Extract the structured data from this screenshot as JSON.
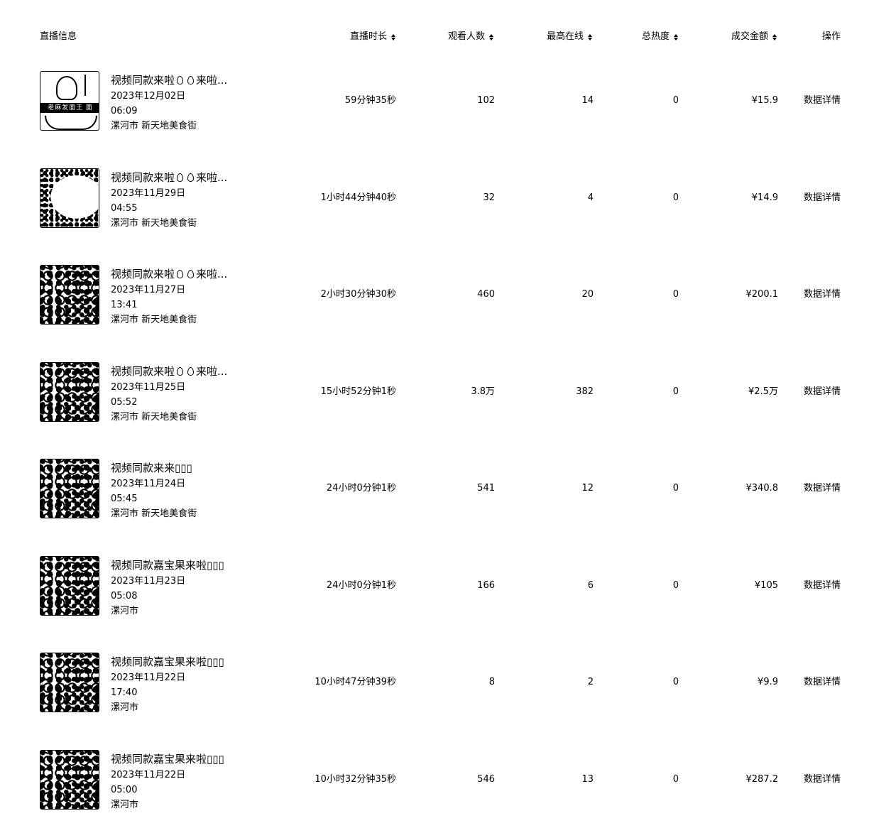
{
  "columns": {
    "info": "直播信息",
    "duration": "直播时长",
    "viewers": "观看人数",
    "peak": "最高在线",
    "heat": "总热度",
    "gmv": "成交金额",
    "ops": "操作"
  },
  "rows": [
    {
      "title_a": "视频同款来啦",
      "title_b": "来啦...",
      "title_icons": 2,
      "date": "2023年12月02日",
      "time": "06:09",
      "location": "漯河市 新天地美食街",
      "thumb": "poster",
      "thumb_text": "老麻发面王 面",
      "duration": "59分钟35秒",
      "viewers": "102",
      "peak": "14",
      "heat": "0",
      "gmv": "¥15.9",
      "action": "数据详情"
    },
    {
      "title_a": "视频同款来啦",
      "title_b": "来啦...",
      "title_icons": 2,
      "date": "2023年11月29日",
      "time": "04:55",
      "location": "漯河市 新天地美食街",
      "thumb": "dog",
      "duration": "1小时44分钟40秒",
      "viewers": "32",
      "peak": "4",
      "heat": "0",
      "gmv": "¥14.9",
      "action": "数据详情"
    },
    {
      "title_a": "视频同款来啦",
      "title_b": "来啦...",
      "title_icons": 2,
      "date": "2023年11月27日",
      "time": "13:41",
      "location": "漯河市 新天地美食街",
      "thumb": "noise",
      "duration": "2小时30分钟30秒",
      "viewers": "460",
      "peak": "20",
      "heat": "0",
      "gmv": "¥200.1",
      "action": "数据详情"
    },
    {
      "title_a": "视频同款来啦",
      "title_b": "来啦...",
      "title_icons": 2,
      "date": "2023年11月25日",
      "time": "05:52",
      "location": "漯河市 新天地美食街",
      "thumb": "noise",
      "duration": "15小时52分钟1秒",
      "viewers": "3.8万",
      "peak": "382",
      "heat": "0",
      "gmv": "¥2.5万",
      "action": "数据详情"
    },
    {
      "title_a": "视频同款来来▯▯▯",
      "title_b": "",
      "title_icons": 0,
      "date": "2023年11月24日",
      "time": "05:45",
      "location": "漯河市 新天地美食街",
      "thumb": "noise",
      "duration": "24小时0分钟1秒",
      "viewers": "541",
      "peak": "12",
      "heat": "0",
      "gmv": "¥340.8",
      "action": "数据详情"
    },
    {
      "title_a": "视频同款嘉宝果来啦▯▯▯",
      "title_b": "",
      "title_icons": 0,
      "date": "2023年11月23日",
      "time": "05:08",
      "location": "漯河市",
      "thumb": "noise",
      "duration": "24小时0分钟1秒",
      "viewers": "166",
      "peak": "6",
      "heat": "0",
      "gmv": "¥105",
      "action": "数据详情"
    },
    {
      "title_a": "视频同款嘉宝果来啦▯▯▯",
      "title_b": "",
      "title_icons": 0,
      "date": "2023年11月22日",
      "time": "17:40",
      "location": "漯河市",
      "thumb": "noise",
      "duration": "10小时47分钟39秒",
      "viewers": "8",
      "peak": "2",
      "heat": "0",
      "gmv": "¥9.9",
      "action": "数据详情"
    },
    {
      "title_a": "视频同款嘉宝果来啦▯▯▯",
      "title_b": "",
      "title_icons": 0,
      "date": "2023年11月22日",
      "time": "05:00",
      "location": "漯河市",
      "thumb": "noise",
      "duration": "10小时32分钟35秒",
      "viewers": "546",
      "peak": "13",
      "heat": "0",
      "gmv": "¥287.2",
      "action": "数据详情"
    }
  ]
}
